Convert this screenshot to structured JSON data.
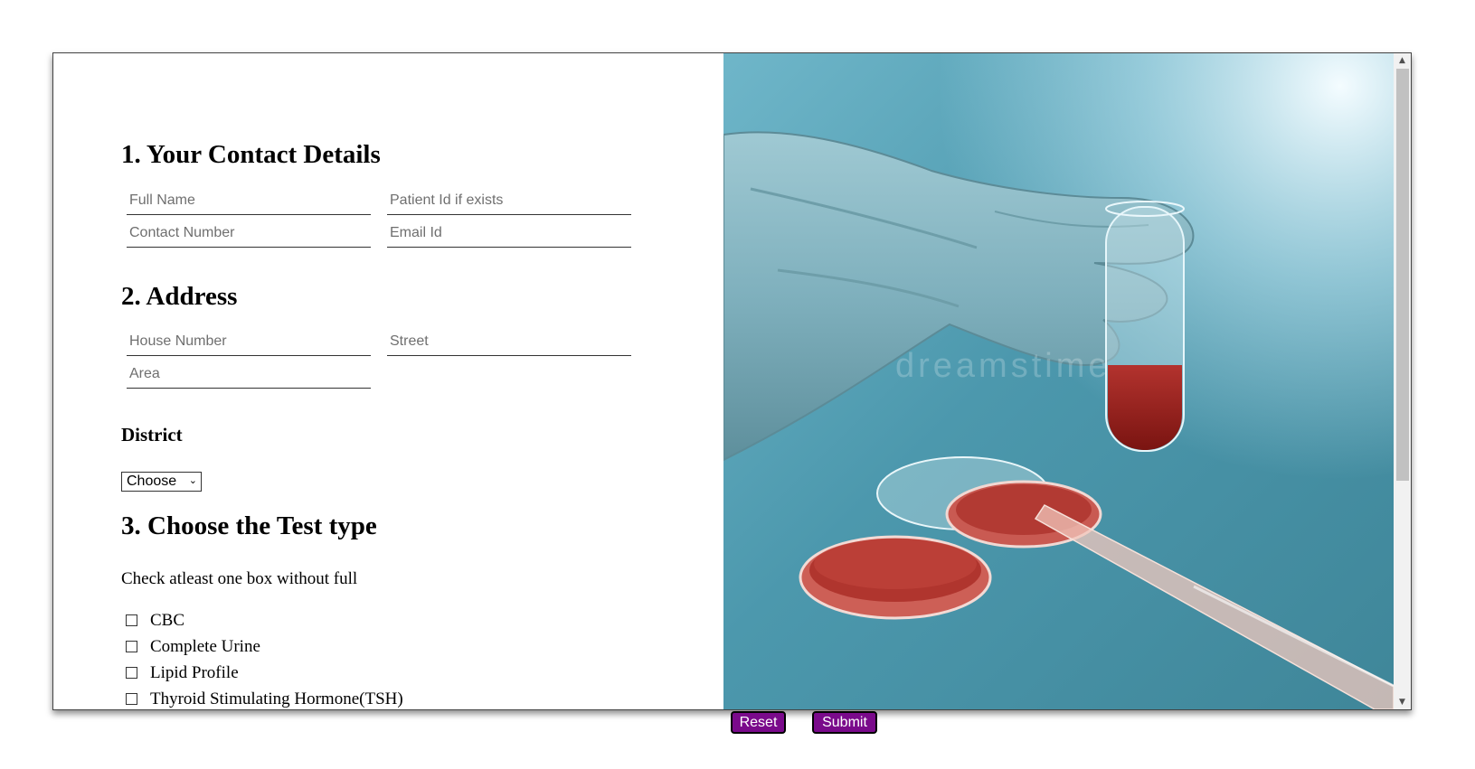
{
  "form": {
    "contact_heading": "1. Your Contact Details",
    "full_name_placeholder": "Full Name",
    "patient_id_placeholder": "Patient Id if exists",
    "contact_number_placeholder": "Contact Number",
    "email_placeholder": "Email Id",
    "address_heading": "2. Address",
    "house_number_placeholder": "House Number",
    "street_placeholder": "Street",
    "area_placeholder": "Area",
    "district_label": "District",
    "district_selected": "Choose",
    "test_heading": "3. Choose the Test type",
    "test_instruction": "Check atleast one box without full",
    "tests": [
      "CBC",
      "Complete Urine",
      "Lipid Profile",
      "Thyroid Stimulating Hormone(TSH)"
    ]
  },
  "photo": {
    "watermark": "dreamstime"
  },
  "actions": {
    "reset_label": "Reset",
    "submit_label": "Submit"
  },
  "colors": {
    "button_bg": "#7a0a8b",
    "photo_bg": "#4b95aa"
  }
}
